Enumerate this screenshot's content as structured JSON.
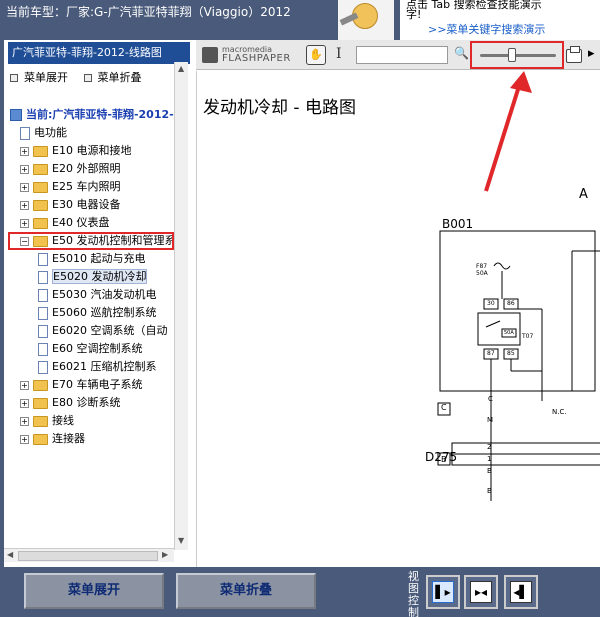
{
  "header": {
    "vehicle_text": "当前车型：厂家:G-广汽菲亚特菲翔（Viaggio）2012",
    "notice_line1": "点击  Tab     搜索检查技能演示",
    "notice_line2": "字!",
    "notice_link": ">>菜单关键字搜索演示"
  },
  "left_panel": {
    "title": "广汽菲亚特-菲翔-2012-线路图",
    "expand_label": "菜单展开",
    "collapse_label": "菜单折叠",
    "tree": [
      {
        "label": "当前:广汽菲亚特-菲翔-2012-线",
        "kind": "root"
      },
      {
        "label": "电功能",
        "kind": "doc"
      },
      {
        "label": "E10 电源和接地",
        "kind": "folder"
      },
      {
        "label": "E20 外部照明",
        "kind": "folder"
      },
      {
        "label": "E25 车内照明",
        "kind": "folder"
      },
      {
        "label": "E30 电器设备",
        "kind": "folder"
      },
      {
        "label": "E40 仪表盘",
        "kind": "folder"
      },
      {
        "label": "E50 发动机控制和管理系",
        "kind": "folder-open"
      },
      {
        "label": "E5010 起动与充电",
        "kind": "doc"
      },
      {
        "label": "E5020 发动机冷却",
        "kind": "doc-selected"
      },
      {
        "label": "E5030 汽油发动机电",
        "kind": "doc"
      },
      {
        "label": "E5060 巡航控制系统",
        "kind": "doc"
      },
      {
        "label": "E6020 空调系统（自动",
        "kind": "doc"
      },
      {
        "label": "E60 空调控制系统",
        "kind": "doc"
      },
      {
        "label": "E6021 压缩机控制系",
        "kind": "doc"
      },
      {
        "label": "E70 车辆电子系统",
        "kind": "folder"
      },
      {
        "label": "E80 诊断系统",
        "kind": "folder"
      },
      {
        "label": "接线",
        "kind": "folder"
      },
      {
        "label": "连接器",
        "kind": "folder"
      }
    ]
  },
  "viewer": {
    "logo_top": "macromedia",
    "logo_bottom": "FLASHPAPER",
    "zoom_level": 0.42,
    "doc_title": "发动机冷却 - 电路图",
    "diagram": {
      "corner_letter": "A",
      "box_label": "B001",
      "fuse_label": "F87",
      "fuse_rating": "50A",
      "pin30": "30",
      "pin86": "86",
      "pin87": "87",
      "pin85": "85",
      "relay_id": "T07",
      "relay_tag": "50A",
      "conn_c": "C",
      "conn_c2": "C",
      "wire_m": "M",
      "wire_nc": "N.C.",
      "b_conn": "B",
      "d_label": "D275",
      "pin2": "2",
      "pin1": "1",
      "wire_b1": "B",
      "wire_b2": "B"
    }
  },
  "bottom_bar": {
    "expand_button": "菜单展开",
    "collapse_button": "菜单折叠",
    "view_control_label": "视图控制"
  },
  "colors": {
    "frame": "#4a5a7a",
    "highlight": "#e0272a",
    "tree_title_bg": "#1f4e97"
  }
}
